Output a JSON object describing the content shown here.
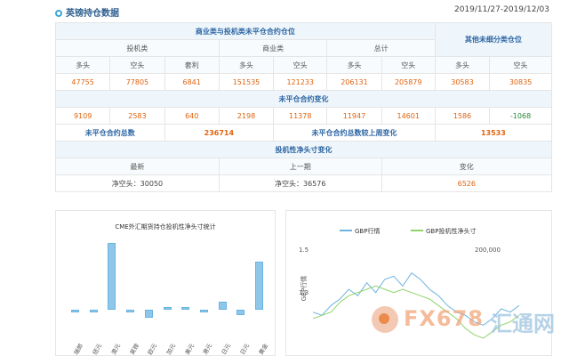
{
  "header": {
    "title": "英镑持仓数据",
    "date_range": "2019/11/27-2019/12/03"
  },
  "table": {
    "section_commercial_noncommercial": "商业类与投机类未平仓合约仓位",
    "section_other": "其他未细分类仓位",
    "group_spec": "投机类",
    "group_comm": "商业类",
    "group_total": "总计",
    "col_long": "多头",
    "col_short": "空头",
    "col_spread": "套利",
    "positions": [
      "47755",
      "77805",
      "6841",
      "151535",
      "121233",
      "206131",
      "205879",
      "30583",
      "30835"
    ],
    "section_change": "未平仓合约变化",
    "changes": [
      "9109",
      "2583",
      "640",
      "2198",
      "11378",
      "11947",
      "14601",
      "1586",
      "-1068"
    ],
    "total_oi_label": "未平仓合约总数",
    "total_oi_value": "236714",
    "oi_change_label": "未平仓合约总数较上周变化",
    "oi_change_value": "13533",
    "section_net": "投机性净头寸变化",
    "col_latest": "最新",
    "col_prev": "上一期",
    "col_change": "变化",
    "net_latest": "净空头：30050",
    "net_prev": "净空头：36576",
    "net_change": "6526"
  },
  "chart_left": {
    "title": "CME外汇期货持仓投机性净头寸统计",
    "chart_data": {
      "type": "bar",
      "title": "CME外汇期货持仓投机性净头寸统计",
      "categories": [
        "瑞郎",
        "纽元",
        "澳元",
        "英镑",
        "欧元",
        "加元",
        "美元",
        "港元",
        "日元",
        "日元",
        "黄金"
      ],
      "values": [
        -4,
        -4,
        100,
        -4,
        -12,
        4,
        4,
        -4,
        12,
        -8,
        72
      ],
      "ylim": [
        -20,
        110
      ]
    }
  },
  "chart_right": {
    "legend_gbp": "GBP行情",
    "legend_net": "GBP投机性净头寸",
    "y_left_top": "1.5",
    "y_left_mid": "1.3",
    "y_right_top": "200,000",
    "y_axis_label": "GBP行情",
    "colors": {
      "gbp": "#6fb3e0",
      "net": "#90d36b"
    },
    "chart_data": {
      "type": "line",
      "series": [
        {
          "name": "GBP行情",
          "values": [
            1.31,
            1.3,
            1.33,
            1.35,
            1.38,
            1.36,
            1.4,
            1.37,
            1.41,
            1.42,
            1.39,
            1.43,
            1.41,
            1.38,
            1.36,
            1.33,
            1.31,
            1.3,
            1.28,
            1.27,
            1.29,
            1.32,
            1.31,
            1.33
          ]
        },
        {
          "name": "GBP投机性净头寸",
          "values": [
            1.29,
            1.3,
            1.31,
            1.34,
            1.36,
            1.37,
            1.38,
            1.39,
            1.38,
            1.37,
            1.38,
            1.37,
            1.36,
            1.35,
            1.33,
            1.31,
            1.29,
            1.26,
            1.24,
            1.23,
            1.25,
            1.27,
            1.28,
            1.3
          ]
        }
      ],
      "ylim": [
        1.2,
        1.5
      ]
    }
  },
  "watermark": {
    "brand": "FX678",
    "brand_cn": "汇通网"
  }
}
